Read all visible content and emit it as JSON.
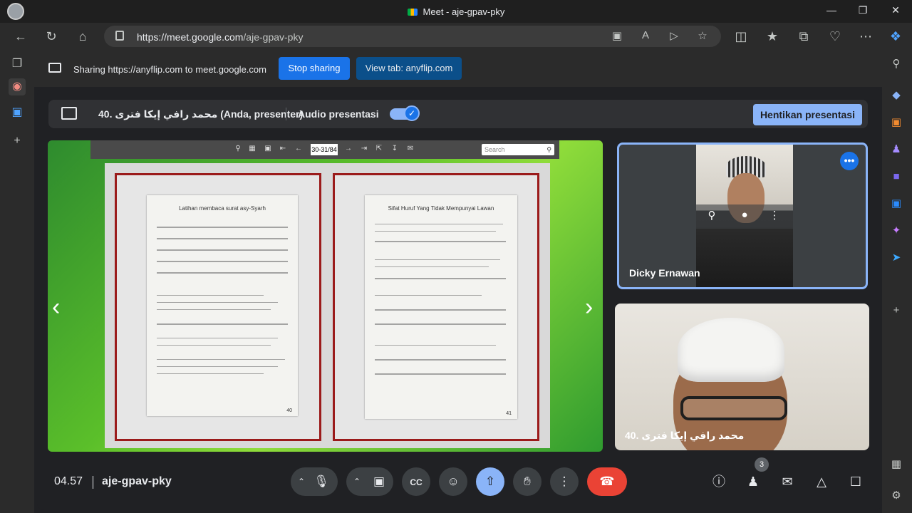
{
  "browser": {
    "window_title": "Meet - aje-gpav-pky",
    "url_host": "https://meet.google.com",
    "url_path": "/aje-gpav-pky"
  },
  "sharing_bar": {
    "text": "Sharing https://anyflip.com to meet.google.com",
    "stop_label": "Stop sharing",
    "view_tab_label": "View tab: anyflip.com"
  },
  "presenter_bar": {
    "presenter_name": "40. محمد رافي إيكا فترى (Anda, presenter)",
    "audio_label": "Audio presentasi",
    "audio_on": true,
    "stop_label": "Hentikan presentasi"
  },
  "flipbook": {
    "page_indicator": "30-31/84",
    "search_placeholder": "Search",
    "left_page": {
      "title": "Latihan membaca surat asy-Syarh",
      "page_number": "40"
    },
    "right_page": {
      "title": "Sifat Huruf Yang Tidak Mempunyai Lawan",
      "page_number": "41"
    }
  },
  "participants": [
    {
      "name": "Dicky Ernawan"
    },
    {
      "name": "40. محمد رافي إيكا فترى"
    }
  ],
  "bottom_bar": {
    "time": "04.57",
    "meeting_code": "aje-gpav-pky",
    "participant_count": "3"
  },
  "colors": {
    "accent": "#8ab4f8",
    "primary_blue": "#1a73e8",
    "leave_red": "#ea4335",
    "background": "#202124"
  }
}
